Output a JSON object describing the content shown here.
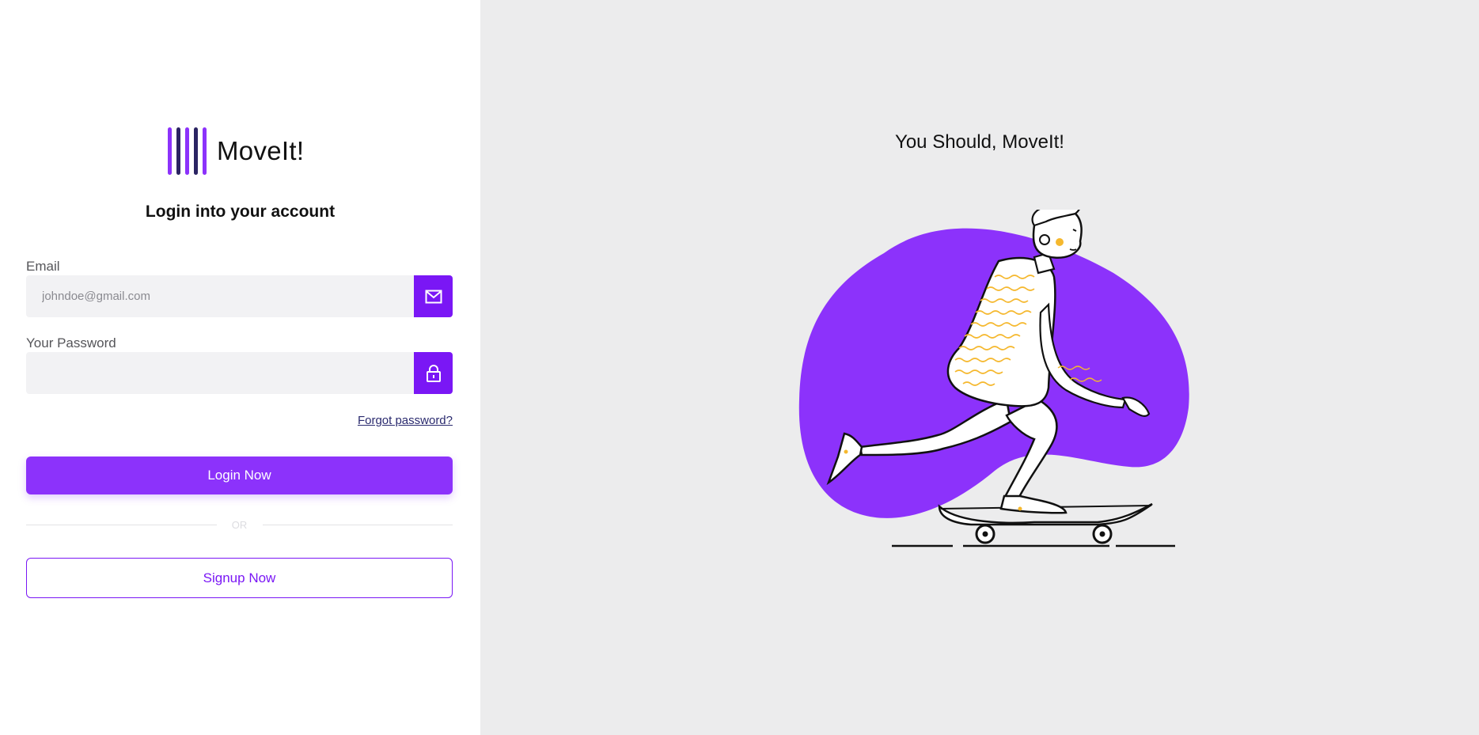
{
  "brand": {
    "name": "MoveIt!",
    "logo_colors": [
      "#8c32fb",
      "#2b2463",
      "#8c32fb",
      "#2b2463",
      "#8c32fb"
    ]
  },
  "login": {
    "title": "Login into your account",
    "email_label": "Email",
    "email_placeholder": "johndoe@gmail.com",
    "email_icon": "envelope-icon",
    "password_label": "Your Password",
    "password_placeholder": "",
    "password_icon": "lock-icon",
    "forgot_label": "Forgot password?",
    "login_button": "Login Now",
    "divider_text": "OR",
    "signup_button": "Signup Now"
  },
  "hero": {
    "tagline": "You Should, MoveIt!",
    "illustration": "skateboarder-illustration"
  },
  "colors": {
    "accent": "#8c32fb",
    "accent_dark": "#7a17f5",
    "panel_bg": "#ececed",
    "input_bg": "#f2f2f4"
  }
}
